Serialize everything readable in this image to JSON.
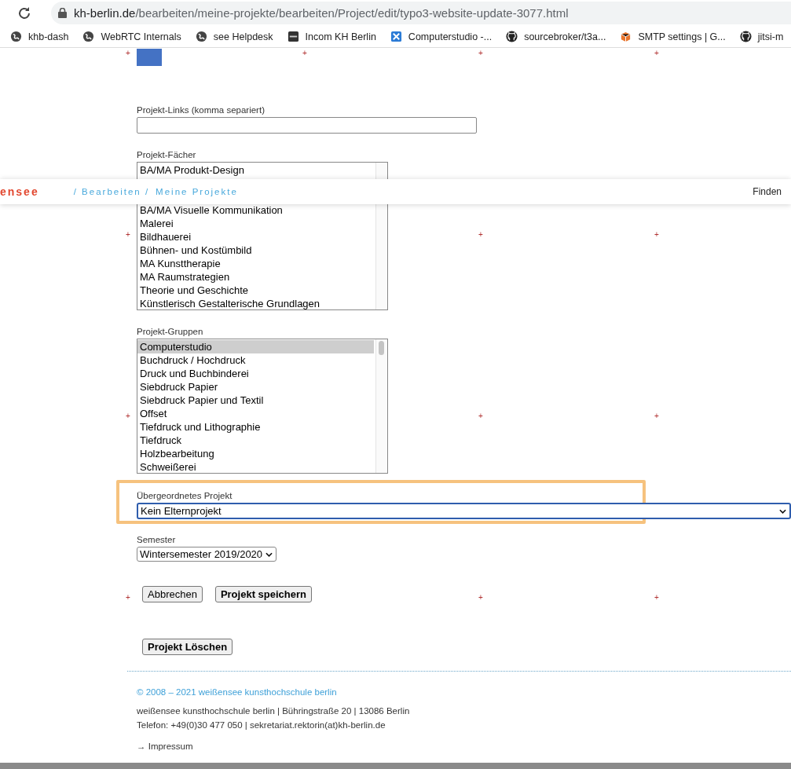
{
  "browser": {
    "url_host": "kh-berlin.de",
    "url_path": "/bearbeiten/meine-projekte/bearbeiten/Project/edit/typo3-website-update-3077.html",
    "bookmarks": [
      {
        "label": "khb-dash"
      },
      {
        "label": "WebRTC Internals"
      },
      {
        "label": "see Helpdesk"
      },
      {
        "label": "Incom KH Berlin"
      },
      {
        "label": "Computerstudio -..."
      },
      {
        "label": "sourcebroker/t3a..."
      },
      {
        "label": "SMTP settings | G..."
      },
      {
        "label": "jitsi-m"
      }
    ]
  },
  "sticky_header": {
    "logo": "ensee",
    "breadcrumb": [
      "/ Bearbeiten /",
      "Meine Projekte"
    ],
    "search_link": "Finden"
  },
  "grid_marks": [
    {
      "marks": [
        "+",
        "+",
        "+",
        "+"
      ]
    },
    {
      "marks": [
        "+",
        "+",
        "+"
      ]
    },
    {
      "marks": [
        "+",
        "+",
        "+"
      ]
    },
    {
      "marks": [
        "+",
        "+",
        "+"
      ]
    }
  ],
  "form": {
    "links": {
      "label": "Projekt-Links (komma separiert)"
    },
    "subjects": {
      "label": "Projekt-Fächer",
      "options": [
        {
          "text": "BA/MA Produkt-Design",
          "selected": false
        },
        {
          "text": "BA/MA Visuelle Kommunikation",
          "selected": false
        },
        {
          "text": "Malerei",
          "selected": false
        },
        {
          "text": "Bildhauerei",
          "selected": false
        },
        {
          "text": "Bühnen- und Kostümbild",
          "selected": false
        },
        {
          "text": "MA Kunsttherapie",
          "selected": false
        },
        {
          "text": "MA Raumstrategien",
          "selected": false
        },
        {
          "text": "Theorie und Geschichte",
          "selected": false
        },
        {
          "text": "Künstlerisch Gestalterische Grundlagen",
          "selected": false
        }
      ]
    },
    "groups": {
      "label": "Projekt-Gruppen",
      "options": [
        {
          "text": "Computerstudio",
          "selected": true
        },
        {
          "text": "Buchdruck / Hochdruck",
          "selected": false
        },
        {
          "text": "Druck und Buchbinderei",
          "selected": false
        },
        {
          "text": "Siebdruck Papier",
          "selected": false
        },
        {
          "text": "Siebdruck Papier und Textil",
          "selected": false
        },
        {
          "text": "Offset",
          "selected": false
        },
        {
          "text": "Tiefdruck und Lithographie",
          "selected": false
        },
        {
          "text": "Tiefdruck",
          "selected": false
        },
        {
          "text": "Holzbearbeitung",
          "selected": false
        },
        {
          "text": "Schweißerei",
          "selected": false
        }
      ]
    },
    "parent": {
      "label": "Übergeordnetes Projekt",
      "value": "Kein Elternprojekt",
      "focused": true,
      "highlighted": true
    },
    "semester": {
      "label": "Semester",
      "value": "Wintersemester 2019/2020",
      "focused": false
    },
    "buttons": [
      {
        "label": "Abbrechen",
        "primary": false
      },
      {
        "label": "Projekt speichern",
        "primary": true
      }
    ],
    "delete_button": {
      "label": "Projekt Löschen"
    }
  },
  "footer": {
    "copyright": "© 2008 – 2021 weißensee kunsthochschule berlin",
    "address": "weißensee kunsthochschule berlin | Bühringstraße 20 | 13086 Berlin",
    "contact": "Telefon: +49(0)30 477 050 | sekretariat.rektorin(at)kh-berlin.de",
    "imprint": "→ Impressum"
  }
}
